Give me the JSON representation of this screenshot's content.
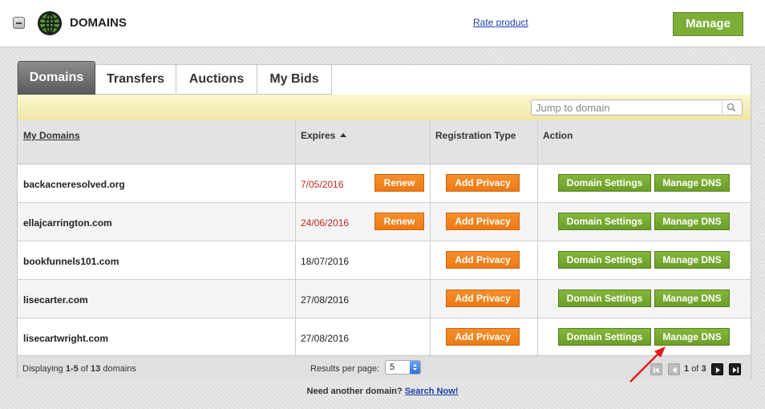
{
  "header": {
    "title": "DOMAINS",
    "rate_link": "Rate product",
    "manage_label": "Manage"
  },
  "tabs": [
    {
      "label": "Domains",
      "active": true
    },
    {
      "label": "Transfers",
      "active": false
    },
    {
      "label": "Auctions",
      "active": false
    },
    {
      "label": "My Bids",
      "active": false
    }
  ],
  "search": {
    "placeholder": "Jump to domain",
    "icon": "search-icon"
  },
  "table": {
    "columns": {
      "my_domains": "My Domains",
      "expires": "Expires",
      "registration_type": "Registration Type",
      "action": "Action"
    },
    "rows": [
      {
        "domain": "backacneresolved.org",
        "expires": "7/05/2016",
        "expiring": true,
        "renew_label": "Renew",
        "privacy_label": "Add Privacy",
        "settings_label": "Domain Settings",
        "dns_label": "Manage DNS"
      },
      {
        "domain": "ellajcarrington.com",
        "expires": "24/06/2016",
        "expiring": true,
        "renew_label": "Renew",
        "privacy_label": "Add Privacy",
        "settings_label": "Domain Settings",
        "dns_label": "Manage DNS"
      },
      {
        "domain": "bookfunnels101.com",
        "expires": "18/07/2016",
        "expiring": false,
        "privacy_label": "Add Privacy",
        "settings_label": "Domain Settings",
        "dns_label": "Manage DNS"
      },
      {
        "domain": "lisecarter.com",
        "expires": "27/08/2016",
        "expiring": false,
        "privacy_label": "Add Privacy",
        "settings_label": "Domain Settings",
        "dns_label": "Manage DNS"
      },
      {
        "domain": "lisecartwright.com",
        "expires": "27/08/2016",
        "expiring": false,
        "privacy_label": "Add Privacy",
        "settings_label": "Domain Settings",
        "dns_label": "Manage DNS"
      }
    ]
  },
  "footer": {
    "displaying_prefix": "Displaying",
    "displaying_range": "1-5",
    "displaying_of": "of",
    "displaying_total": "13",
    "displaying_suffix": "domains",
    "results_per_page_label": "Results per page:",
    "results_per_page_value": "5",
    "page_current": "1",
    "page_of": "of",
    "page_total": "3"
  },
  "bottom": {
    "need_text": "Need another domain?",
    "search_link": "Search Now!"
  },
  "colors": {
    "accent_green": "#7cae37",
    "accent_orange": "#f0821d",
    "expired_red": "#c0271d",
    "link_blue": "#1a3fa8",
    "annotation_red": "#e31b1b"
  }
}
